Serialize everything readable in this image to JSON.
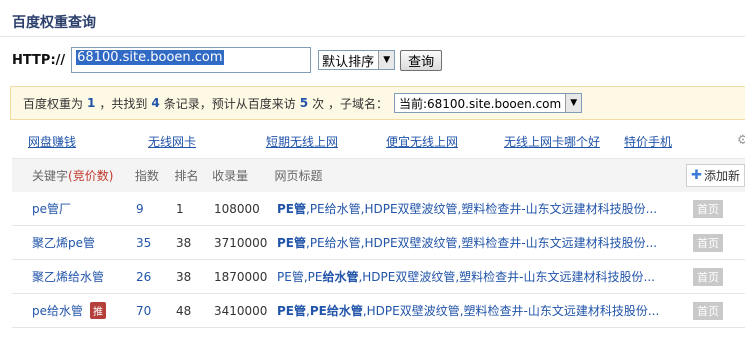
{
  "page": {
    "title": "百度权重查询"
  },
  "search": {
    "label": "HTTP://",
    "url_value": "68100.site.booen.com",
    "sort_selected": "默认排序",
    "submit_label": "查询"
  },
  "info": {
    "t1": "百度权重为",
    "weight": "1",
    "t2": "，共找到",
    "records": "4",
    "t3": "条记录，预计从百度来访",
    "visits": "5",
    "t4": "次 ，子域名：",
    "subdomain_selected": "当前:68100.site.booen.com"
  },
  "ad_links": [
    "网盘赚钱",
    "无线网卡",
    "短期无线上网",
    "便宜无线上网",
    "无线上网卡哪个好",
    "特价手机"
  ],
  "table": {
    "headers": {
      "keyword": "关键字",
      "bid": "(竞价数)",
      "index": "指数",
      "rank": "排名",
      "count": "收录量",
      "page_title": "网页标题",
      "add_new": "添加新"
    },
    "rows": [
      {
        "keyword": "pe管厂",
        "index": "9",
        "rank": "1",
        "count": "108000",
        "title_bold": "PE管",
        "title_rest": ",PE给水管,HDPE双壁波纹管,塑料检查井-山东文远建材科技股份...",
        "home": "首页",
        "tui": ""
      },
      {
        "keyword": "聚乙烯pe管",
        "index": "35",
        "rank": "38",
        "count": "3710000",
        "title_bold": "PE管",
        "title_rest": ",PE给水管,HDPE双壁波纹管,塑料检查井-山东文远建材科技股份...",
        "home": "首页",
        "tui": ""
      },
      {
        "keyword": "聚乙烯给水管",
        "index": "26",
        "rank": "38",
        "count": "1870000",
        "title_pre": "PE管,PE",
        "title_bold2": "给水管",
        "title_rest2": ",HDPE双壁波纹管,塑料检查井-山东文远建材科技股份...",
        "home": "首页",
        "tui": ""
      },
      {
        "keyword": "pe给水管",
        "index": "70",
        "rank": "48",
        "count": "3410000",
        "title_bold3": "PE管",
        "title_mid3": ",",
        "title_bold3b": "PE给水管",
        "title_rest3": ",HDPE双壁波纹管,塑料检查井-山东文远建材科技股份...",
        "home": "首页",
        "tui": "推"
      }
    ]
  },
  "colors": {
    "accent": "#2255aa",
    "info_bg": "#fef9e5",
    "badge_red": "#b5403b"
  }
}
